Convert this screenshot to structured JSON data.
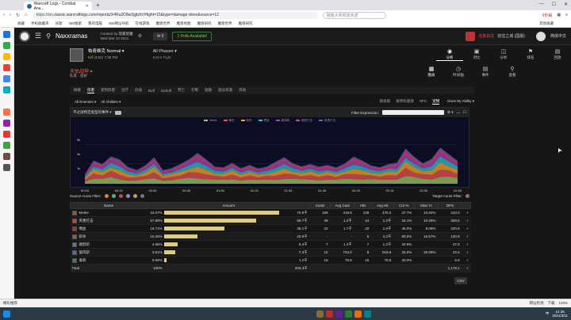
{
  "browser": {
    "tab_title": "Warcraft Logs - Combat Ana...",
    "url_scheme": "https://",
    "url_host": "cn.classic.warcraftlogs.com",
    "url_path": "/reports/X4Ru2D9w3gjtzhV#fight=15&type=damage-done&source=12",
    "search_placeholder": "镜像大师现放赤皮",
    "right_red": "6秒解",
    "bookmarks": [
      "收藏",
      "手机收藏夹",
      "谷歌",
      "360搜索",
      "我的电脑",
      "360网址导航",
      "在线游戏",
      "魔兽世界",
      "魔兽地图",
      "魔兽研究",
      "魔兽世界",
      "魔兽研究"
    ],
    "bookmarks_right": "其他收藏"
  },
  "nav": {
    "site_name": "Naxxramas",
    "created_by_label": "Created by",
    "created_by_name": "玩家优雅",
    "created_date": "Wed Mar 10 2021",
    "msg_count": "0",
    "polls": "1 Polls Available!",
    "guild_tag": "北京白文",
    "guild_name": "前往之城 (国服)",
    "lang": "简体中文"
  },
  "fight": {
    "boss_name": "帕奇维克 Normal",
    "boss_sub": "Kill (2:52)",
    "boss_time": "7:35 PM",
    "phase": "All Phases",
    "phase_sub": "Entire Fight"
  },
  "view_tabs": [
    {
      "label": "分析",
      "icon": "◉",
      "active": true
    },
    {
      "label": "对比",
      "icon": "▣",
      "active": false
    },
    {
      "label": "分析",
      "icon": "◫",
      "active": false
    },
    {
      "label": "排名",
      "icon": "⚑",
      "active": false
    },
    {
      "label": "回放",
      "icon": "▤",
      "active": false
    }
  ],
  "player": {
    "name": "天佑战神",
    "class": "队友 · 首好"
  },
  "sub_tabs": [
    {
      "label": "图表",
      "icon": "▦",
      "active": true
    },
    {
      "label": "时间轴",
      "icon": "◷",
      "active": false
    },
    {
      "label": "事件",
      "icon": "▤",
      "active": false
    },
    {
      "label": "查看",
      "icon": "⚲",
      "active": false
    }
  ],
  "row_tabs": [
    "摘要",
    "伤害",
    "受到伤害",
    "治疗",
    "仇恨",
    "Buff",
    "Debuff",
    "死亡",
    "打断",
    "驱散",
    "施法资源",
    "其他"
  ],
  "row_tabs_active": 1,
  "filters": {
    "enemies": "All Enemies",
    "abilities": "All Abilities",
    "right": [
      "按技能",
      "按目标施放",
      "NPC",
      "宠物"
    ],
    "right_active": 3,
    "sort": "Done By Ability"
  },
  "chart_bar": {
    "label": "不过滤特定类型的事件",
    "filter_expression": "Filter Expression:"
  },
  "chart_data": {
    "type": "area",
    "legend": [
      "Melee",
      "毒击",
      "斩杀",
      "嗜血",
      "旋风斩",
      "致死打击",
      "英勇打击"
    ],
    "colors": [
      "#9ccc65",
      "#ef5350",
      "#ffa726",
      "#26c6da",
      "#ab47bc",
      "#ec407a",
      "#5c6bc0"
    ],
    "x": [
      "00:00",
      "00:15",
      "00:30",
      "00:45",
      "01:00",
      "01:15",
      "01:30",
      "01:45",
      "02:00",
      "02:15",
      "02:30",
      "02:45"
    ],
    "y_ticks": [
      "5k",
      "3k",
      "1k"
    ],
    "ylim": [
      0,
      6000
    ],
    "series_total": [
      1400,
      2100,
      1800,
      2600,
      2200,
      1500,
      1300,
      1700,
      2400,
      1900,
      1400,
      1800,
      2300,
      2800,
      2200,
      1600,
      1500,
      1900,
      2100,
      1700,
      1400,
      1600,
      2000,
      2400,
      1900,
      1600,
      1800,
      2200,
      1700,
      1500,
      1900,
      2500,
      2100,
      1700,
      1500,
      1800,
      2600,
      3200,
      2500,
      1900,
      2300,
      3300,
      2700,
      2100
    ]
  },
  "auras": {
    "source_label": "Source Auras Filter:",
    "target_label": "Target Auras Filter:"
  },
  "table": {
    "headers": [
      "Name",
      "Amount",
      "Casts",
      "Avg Cast",
      "Hits",
      "Avg Hit",
      "Crit %",
      "Miss %",
      "DPS"
    ],
    "rows": [
      {
        "name": "Melee",
        "pct": "34.07%",
        "frac": 1.0,
        "amount": "70.9千",
        "casts": "169",
        "avg_cast": "419.8",
        "hits": "149",
        "avg_hit": "476.2",
        "crit": "47.7%",
        "miss": "10.83%",
        "dps": "410.0"
      },
      {
        "name": "英勇打击",
        "pct": "27.89%",
        "frac": 0.8,
        "amount": "56.7千",
        "casts": "49",
        "avg_cast": "1.2千",
        "hits": "44",
        "avg_hit": "1.3千",
        "crit": "34.1%",
        "miss": "10.20%",
        "dps": "328.5"
      },
      {
        "name": "嗜血",
        "pct": "18.71%",
        "frac": 0.53,
        "amount": "38.1千",
        "casts": "22",
        "avg_cast": "1.7千",
        "hits": "20",
        "avg_hit": "1.9千",
        "crit": "45.0%",
        "miss": "9.09%",
        "dps": "220.6"
      },
      {
        "name": "斩杀",
        "pct": "10.25%",
        "frac": 0.29,
        "amount": "20.9千",
        "casts": "-",
        "avg_cast": "-",
        "hits": "5",
        "avg_hit": "4.2千",
        "crit": "80.0%",
        "miss": "16.67%",
        "dps": "120.8"
      },
      {
        "name": "顺劈斩",
        "pct": "4.06%",
        "frac": 0.12,
        "amount": "8.3千",
        "casts": "7",
        "avg_cast": "1.2千",
        "hits": "7",
        "avg_hit": "1.2千",
        "crit": "42.9%",
        "miss": "",
        "dps": "47.8"
      },
      {
        "name": "旋风斩",
        "pct": "3.61%",
        "frac": 0.1,
        "amount": "7.3千",
        "casts": "10",
        "avg_cast": "734.0",
        "hits": "8",
        "avg_hit": "918.6",
        "crit": "25.0%",
        "miss": "20.00%",
        "dps": "42.5"
      },
      {
        "name": "毒刺",
        "pct": "0.59%",
        "frac": 0.02,
        "amount": "1.2千",
        "casts": "15",
        "avg_cast": "79.5",
        "hits": "15",
        "avg_hit": "79.5",
        "crit": "40.0%",
        "miss": "",
        "dps": "6.9"
      }
    ],
    "total": {
      "label": "Total",
      "pct": "100%",
      "amount": "203.4千",
      "dps": "1,178.1"
    }
  },
  "csv_label": "CSV",
  "statusbar": {
    "left": "精彩推荐",
    "right": [
      "网址检测",
      "下载",
      "100%"
    ]
  },
  "taskbar": {
    "tray_text": "中",
    "time": "14:36",
    "date": "2021/3/11"
  }
}
